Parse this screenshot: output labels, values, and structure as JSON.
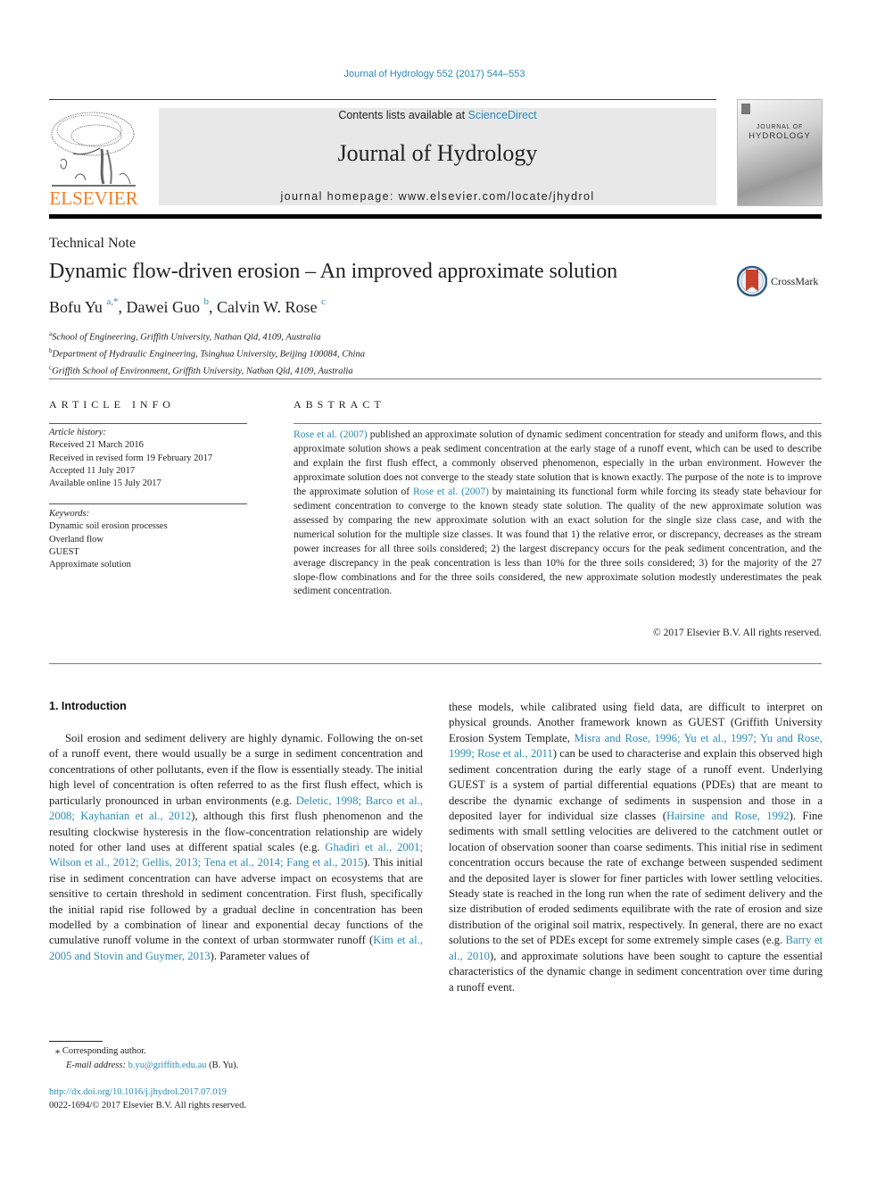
{
  "running_head": "Journal of Hydrology 552 (2017) 544–553",
  "publisher": {
    "name": "ELSEVIER",
    "brand_color": "#f07e26"
  },
  "masthead": {
    "contents_prefix": "Contents lists available at ",
    "contents_link": "ScienceDirect",
    "journal_title": "Journal of Hydrology",
    "homepage": "journal homepage: www.elsevier.com/locate/jhydrol"
  },
  "cover": {
    "line1": "JOURNAL OF",
    "line2": "HYDROLOGY"
  },
  "article": {
    "type": "Technical Note",
    "title": "Dynamic flow-driven erosion – An improved approximate solution",
    "crossmark_label": "CrossMark",
    "authors": [
      {
        "name": "Bofu Yu",
        "sup": "a,*",
        "sep": ", "
      },
      {
        "name": "Dawei Guo",
        "sup": "b",
        "sep": ", "
      },
      {
        "name": "Calvin W. Rose",
        "sup": "c",
        "sep": ""
      }
    ],
    "affiliations": [
      {
        "mark": "a",
        "text": "School of Engineering, Griffith University, Nathan Qld, 4109, Australia"
      },
      {
        "mark": "b",
        "text": "Department of Hydraulic Engineering, Tsinghua University, Beijing 100084, China"
      },
      {
        "mark": "c",
        "text": "Griffith School of Environment, Griffith University, Nathan Qld, 4109, Australia"
      }
    ]
  },
  "article_info": {
    "heading": "ARTICLE INFO",
    "history_label": "Article history:",
    "history": [
      "Received 21 March 2016",
      "Received in revised form 19 February 2017",
      "Accepted 11 July 2017",
      "Available online 15 July 2017"
    ],
    "keywords_label": "Keywords:",
    "keywords": [
      "Dynamic soil erosion processes",
      "Overland flow",
      "GUEST",
      "Approximate solution"
    ]
  },
  "abstract": {
    "heading": "ABSTRACT",
    "segments": [
      {
        "text": "Rose et al. (2007)",
        "link": true
      },
      {
        "text": " published an approximate solution of dynamic sediment concentration for steady and uniform flows, and this approximate solution shows a peak sediment concentration at the early stage of a runoff event, which can be used to describe and explain the first flush effect, a commonly observed phe­nomenon, especially in the urban environment. However the approximate solution does not converge to the steady state solution that is known exactly. The purpose of the note is to improve the approximate solution of ",
        "link": false
      },
      {
        "text": "Rose et al. (2007)",
        "link": true
      },
      {
        "text": " by maintaining its functional form while forcing its steady state behaviour for sediment concentration to converge to the known steady state solution. The quality of the new approximate solution was assessed by comparing the new approximate solution with an exact solution for the single size class case, and with the numerical solution for the multiple size classes. It was found that 1) the relative error, or discrepancy, decreases as the stream power increases for all three soils con­sidered; 2) the largest discrepancy occurs for the peak sediment concentration, and the average discrep­ancy in the peak concentration is less than 10% for the three soils considered; 3) for the majority of the 27 slope-flow combinations and for the three soils considered, the new approximate solution modestly underestimates the peak sediment concentration.",
        "link": false
      }
    ],
    "copyright": "© 2017 Elsevier B.V. All rights reserved."
  },
  "introduction": {
    "heading": "1. Introduction",
    "left_segments": [
      {
        "text": "Soil erosion and sediment delivery are highly dynamic. Follow­ing the on-set of a runoff event, there would usually be a surge in sediment concentration and concentrations of other pollutants, even if the flow is essentially steady. The initial high level of con­centration is often referred to as the first flush effect, which is par­ticularly pronounced in urban environments (e.g. ",
        "link": false
      },
      {
        "text": "Deletic, 1998; Barco et al., 2008; Kayhanian et al., 2012",
        "link": true
      },
      {
        "text": "), although this first flush phenomenon and the resulting clockwise hysteresis in the flow-concentration relationship are widely noted for other land uses at different spatial scales (e.g. ",
        "link": false
      },
      {
        "text": "Ghadiri et al., 2001; Wilson et al., 2012; Gellis, 2013; Tena et al., 2014; Fang et al., 2015",
        "link": true
      },
      {
        "text": "). This initial rise in sediment concentration can have adverse impact on ecosys­tems that are sensitive to certain threshold in sediment concentra­tion. First flush, specifically the initial rapid rise followed by a gradual decline in concentration has been modelled by a combina­tion of linear and exponential decay functions of the cumulative runoff volume in the context of urban stormwater runoff (",
        "link": false
      },
      {
        "text": "Kim et al., 2005 and Stovin and Guymer, 2013",
        "link": true
      },
      {
        "text": "). Parameter values of",
        "link": false
      }
    ],
    "right_segments": [
      {
        "text": "these models, while calibrated using field data, are difficult to interpret on physical grounds. Another framework known as GUEST (Griffith University Erosion System Template, ",
        "link": false
      },
      {
        "text": "Misra and Rose, 1996; Yu et al., 1997; Yu and Rose, 1999; Rose et al., 2011",
        "link": true
      },
      {
        "text": ") can be used to characterise and explain this observed high sedi­ment concentration during the early stage of a runoff event. Under­lying GUEST is a system of partial differential equations (PDEs) that are meant to describe the dynamic exchange of sediments in sus­pension and those in a deposited layer for individual size classes (",
        "link": false
      },
      {
        "text": "Hairsine and Rose, 1992",
        "link": true
      },
      {
        "text": "). Fine sediments with small settling velocities are delivered to the catchment outlet or location of observation sooner than coarse sediments. This initial rise in sedi­ment concentration occurs because the rate of exchange between suspended sediment and the deposited layer is slower for finer particles with lower settling velocities. Steady state is reached in the long run when the rate of sediment delivery and the size distri­bution of eroded sediments equilibrate with the rate of erosion and size distribution of the original soil matrix, respectively. In general, there are no exact solutions to the set of PDEs except for some extremely simple cases (e.g. ",
        "link": false
      },
      {
        "text": "Barry et al., 2010",
        "link": true
      },
      {
        "text": "), and approximate solutions have been sought to capture the essential characteristics of the dynamic change in sediment concentration over time during a runoff event.",
        "link": false
      }
    ]
  },
  "footnotes": {
    "corresponding_mark": "⁎",
    "corresponding": "Corresponding author.",
    "email_label": "E-mail address: ",
    "email": "b.yu@griffith.edu.au",
    "email_suffix": " (B. Yu)."
  },
  "doi": {
    "url": "http://dx.doi.org/10.1016/j.jhydrol.2017.07.019",
    "issn_line": "0022-1694/© 2017 Elsevier B.V. All rights reserved."
  },
  "colors": {
    "link": "#2a8bb6",
    "masthead_bg": "#e8e8e8",
    "elsevier_orange": "#f07e26",
    "crossmark_red": "#c8412b",
    "crossmark_blue": "#2f5f8a"
  }
}
